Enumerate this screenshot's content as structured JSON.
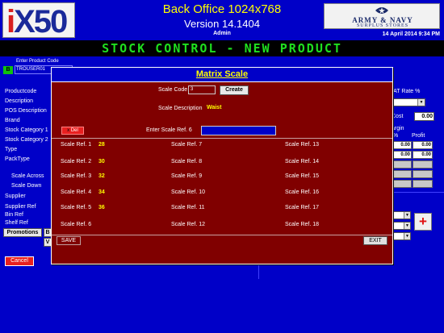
{
  "header": {
    "logo_text": "iX50",
    "title": "Back Office 1024x768",
    "version": "Version 14.1404",
    "user": "Admin",
    "brand_top": "ARMY & NAVY",
    "brand_bottom": "SURPLUS STORES",
    "datetime": "14 April 2014 9:34 PM"
  },
  "marquee": "STOCK CONTROL - NEW PRODUCT",
  "product_form": {
    "product_code_label": "Enter Product Code",
    "product_code_indicator": "B",
    "product_code_value": "TROUSER01",
    "labels": {
      "productcode": "Productcode",
      "description": "Description",
      "pos_description": "POS Description",
      "brand": "Brand",
      "stock_category_1": "Stock Category 1",
      "stock_category_2": "Stock Category 2",
      "type": "Type",
      "packtype": "PackType",
      "scale_across": "Scale Across",
      "scale_down": "Scale Down",
      "supplier": "Supplier",
      "supplier_ref": "Supplier Ref",
      "bin_ref": "Bin Ref",
      "shelf_ref": "Shelf Ref"
    },
    "promotions_label": "Promotions",
    "small_btn_b": "B",
    "small_btn_v": "V",
    "cancel_label": "Cancel",
    "vat_label": "VAT Rate %",
    "cost_label": "Cost",
    "cost_value": "0.00",
    "margin_label": "argin",
    "pct_label": "%",
    "profit_label": "Profit",
    "margin_row_value": "0.00",
    "select_arrow": "▼",
    "plus_label": "+"
  },
  "modal": {
    "title": "Matrix Scale",
    "scale_code_label": "Scale Code",
    "scale_code_value": "3",
    "create_label": "Create",
    "scale_desc_label": "Scale Description",
    "scale_desc_value": "Waist",
    "del_label": "Del",
    "del_x": "x",
    "enter_ref_label": "Enter Scale Ref. 6",
    "scale_refs": {
      "r1": {
        "label": "Scale Ref. 1",
        "value": "28"
      },
      "r2": {
        "label": "Scale Ref. 2",
        "value": "30"
      },
      "r3": {
        "label": "Scale Ref. 3",
        "value": "32"
      },
      "r4": {
        "label": "Scale Ref. 4",
        "value": "34"
      },
      "r5": {
        "label": "Scale Ref. 5",
        "value": "36"
      },
      "r6": {
        "label": "Scale Ref. 6",
        "value": ""
      },
      "r7": {
        "label": "Scale Ref. 7",
        "value": ""
      },
      "r8": {
        "label": "Scale Ref. 8",
        "value": ""
      },
      "r9": {
        "label": "Scale Ref. 9",
        "value": ""
      },
      "r10": {
        "label": "Scale Ref. 10",
        "value": ""
      },
      "r11": {
        "label": "Scale Ref. 11",
        "value": ""
      },
      "r12": {
        "label": "Scale Ref. 12",
        "value": ""
      },
      "r13": {
        "label": "Scale Ref. 13",
        "value": ""
      },
      "r14": {
        "label": "Scale Ref. 14",
        "value": ""
      },
      "r15": {
        "label": "Scale Ref. 15",
        "value": ""
      },
      "r16": {
        "label": "Scale Ref. 16",
        "value": ""
      },
      "r17": {
        "label": "Scale Ref. 17",
        "value": ""
      },
      "r18": {
        "label": "Scale Ref. 18",
        "value": ""
      }
    },
    "save_label": "SAVE",
    "exit_label": "EXIT"
  },
  "colors": {
    "background": "#0000c8",
    "modal": "#800000",
    "highlight": "#ffff00",
    "marquee": "#1fe01f"
  }
}
